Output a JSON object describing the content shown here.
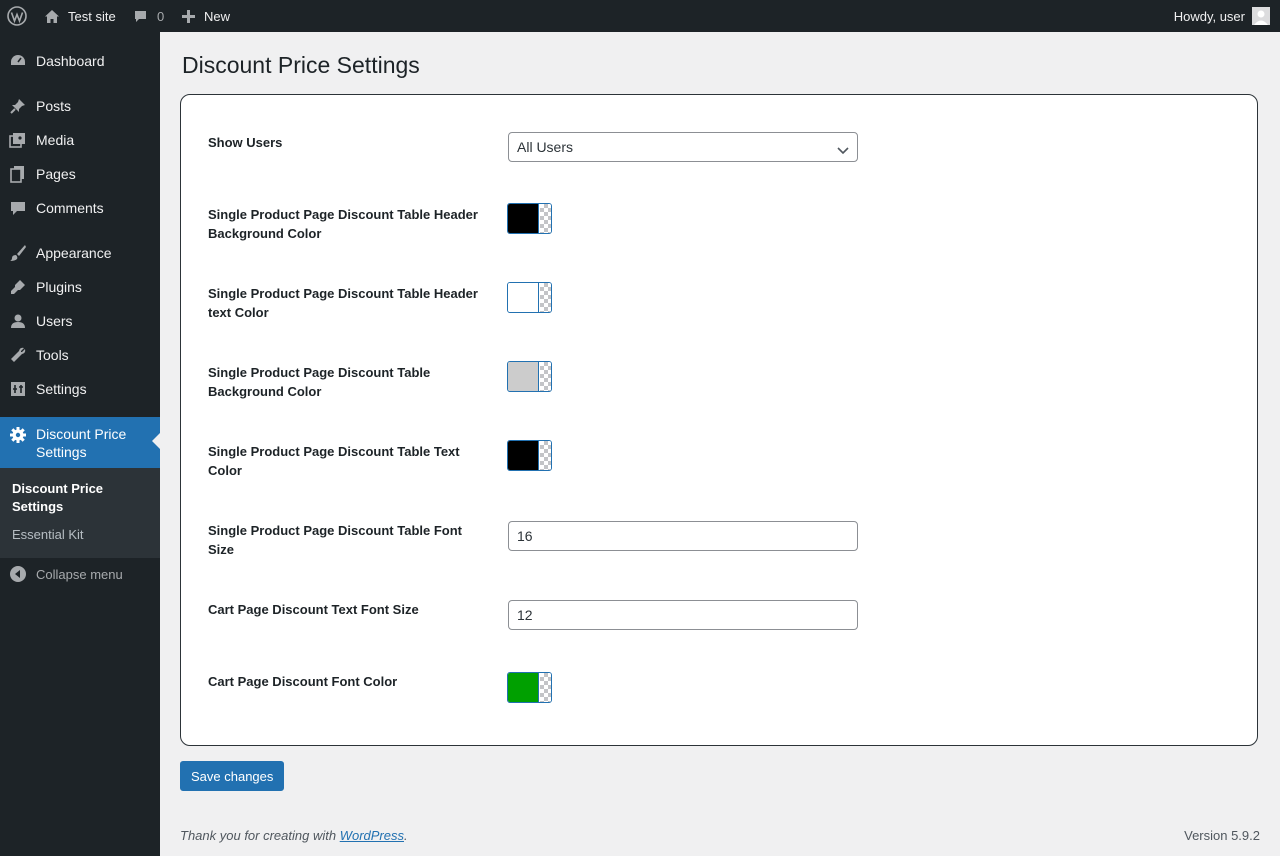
{
  "admin_bar": {
    "site_name": "Test site",
    "comments_count": "0",
    "new_label": "New",
    "howdy": "Howdy, user"
  },
  "sidebar": {
    "items": [
      {
        "label": "Dashboard",
        "icon": "dashboard-icon"
      },
      {
        "label": "Posts",
        "icon": "pin-icon"
      },
      {
        "label": "Media",
        "icon": "media-icon"
      },
      {
        "label": "Pages",
        "icon": "pages-icon"
      },
      {
        "label": "Comments",
        "icon": "comment-icon"
      },
      {
        "label": "Appearance",
        "icon": "brush-icon"
      },
      {
        "label": "Plugins",
        "icon": "plugin-icon"
      },
      {
        "label": "Users",
        "icon": "user-icon"
      },
      {
        "label": "Tools",
        "icon": "wrench-icon"
      },
      {
        "label": "Settings",
        "icon": "settings-icon"
      },
      {
        "label": "Discount Price Settings",
        "icon": "gear-icon"
      }
    ],
    "submenu": [
      "Discount Price Settings",
      "Essential Kit"
    ],
    "collapse_label": "Collapse menu"
  },
  "page": {
    "title": "Discount Price Settings"
  },
  "settings": {
    "show_users": {
      "label": "Show Users",
      "value": "All Users"
    },
    "header_bg": {
      "label": "Single Product Page Discount Table Header Background Color",
      "color": "#000000"
    },
    "header_text": {
      "label": "Single Product Page Discount Table Header text Color",
      "color": "#ffffff"
    },
    "table_bg": {
      "label": "Single Product Page Discount Table Background Color",
      "color": "#cccccc"
    },
    "table_text": {
      "label": "Single Product Page Discount Table Text Color",
      "color": "#000000"
    },
    "table_font_size": {
      "label": "Single Product Page Discount Table Font Size",
      "value": "16"
    },
    "cart_font_size": {
      "label": "Cart Page Discount Text Font Size",
      "value": "12"
    },
    "cart_font_color": {
      "label": "Cart Page Discount Font Color",
      "color": "#00a000"
    }
  },
  "actions": {
    "save_label": "Save changes"
  },
  "footer": {
    "thanks_prefix": "Thank you for creating with ",
    "thanks_link": "WordPress",
    "thanks_suffix": ".",
    "version": "Version 5.9.2"
  },
  "colors": {
    "accent": "#2271b1",
    "admin_dark": "#1d2327"
  }
}
